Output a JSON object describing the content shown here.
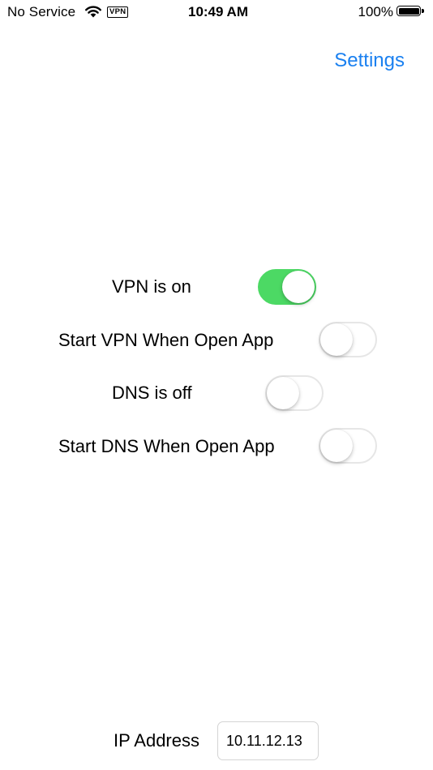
{
  "status_bar": {
    "carrier": "No Service",
    "vpn_badge": "VPN",
    "time": "10:49 AM",
    "battery_percent": "100%"
  },
  "nav": {
    "settings_label": "Settings",
    "accent_color": "#1a80f0"
  },
  "toggles": [
    {
      "label": "VPN is on",
      "on": true
    },
    {
      "label": "Start VPN When Open App",
      "on": false
    },
    {
      "label": "DNS is off",
      "on": false
    },
    {
      "label": "Start DNS When Open App",
      "on": false
    }
  ],
  "ip": {
    "label": "IP Address",
    "value": "10.11.12.13"
  },
  "colors": {
    "switch_on": "#4cd964",
    "switch_off_border": "#e6e6e6"
  },
  "icons": [
    "wifi-icon",
    "battery-icon"
  ]
}
